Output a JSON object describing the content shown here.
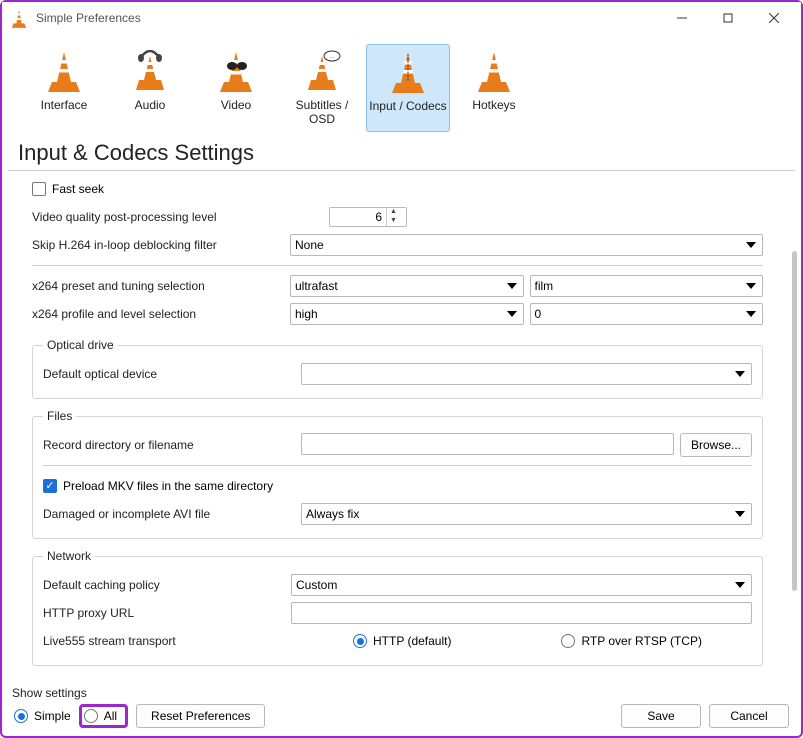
{
  "window": {
    "title": "Simple Preferences"
  },
  "categories": [
    {
      "label": "Interface"
    },
    {
      "label": "Audio"
    },
    {
      "label": "Video"
    },
    {
      "label": "Subtitles / OSD"
    },
    {
      "label": "Input / Codecs",
      "selected": true
    },
    {
      "label": "Hotkeys"
    }
  ],
  "page_heading": "Input & Codecs Settings",
  "codecs": {
    "fast_seek_label": "Fast seek",
    "fast_seek_checked": false,
    "vq_label": "Video quality post-processing level",
    "vq_value": "6",
    "skip_label": "Skip H.264 in-loop deblocking filter",
    "skip_value": "None",
    "x264_preset_label": "x264 preset and tuning selection",
    "x264_preset_value": "ultrafast",
    "x264_tune_value": "film",
    "x264_profile_label": "x264 profile and level selection",
    "x264_profile_value": "high",
    "x264_level_value": "0"
  },
  "optical": {
    "legend": "Optical drive",
    "device_label": "Default optical device",
    "device_value": ""
  },
  "files": {
    "legend": "Files",
    "record_label": "Record directory or filename",
    "record_value": "",
    "browse_label": "Browse...",
    "preload_label": "Preload MKV files in the same directory",
    "preload_checked": true,
    "avi_label": "Damaged or incomplete AVI file",
    "avi_value": "Always fix"
  },
  "network": {
    "legend": "Network",
    "caching_label": "Default caching policy",
    "caching_value": "Custom",
    "proxy_label": "HTTP proxy URL",
    "proxy_value": "",
    "live555_label": "Live555 stream transport",
    "live555_http": "HTTP (default)",
    "live555_rtp": "RTP over RTSP (TCP)",
    "live555_selected": "http"
  },
  "footer": {
    "show_label": "Show settings",
    "simple_label": "Simple",
    "all_label": "All",
    "reset_label": "Reset Preferences",
    "save_label": "Save",
    "cancel_label": "Cancel"
  }
}
